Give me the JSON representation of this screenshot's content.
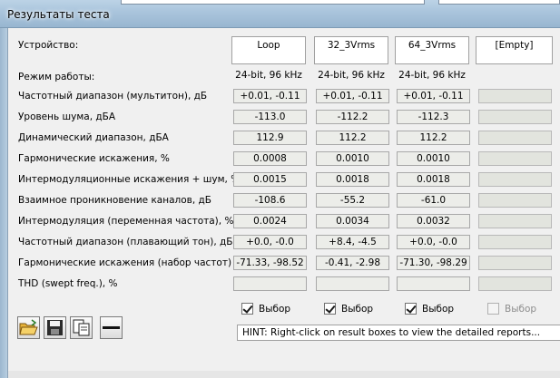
{
  "window": {
    "title": "Результаты теста"
  },
  "device_label": "Устройство:",
  "columns": [
    {
      "header": "Loop",
      "mode": "24-bit, 96 kHz"
    },
    {
      "header": "32_3Vrms",
      "mode": "24-bit, 96 kHz"
    },
    {
      "header": "64_3Vrms",
      "mode": "24-bit, 96 kHz"
    },
    {
      "header": "[Empty]",
      "mode": ""
    }
  ],
  "mode_label": "Режим работы:",
  "rows": [
    {
      "label": "Частотный диапазон (мультитон), дБ",
      "values": [
        "+0.01, -0.11",
        "+0.01, -0.11",
        "+0.01, -0.11",
        ""
      ]
    },
    {
      "label": "Уровень шума, дБА",
      "values": [
        "-113.0",
        "-112.2",
        "-112.3",
        ""
      ]
    },
    {
      "label": "Динамический диапазон, дБА",
      "values": [
        "112.9",
        "112.2",
        "112.2",
        ""
      ]
    },
    {
      "label": "Гармонические искажения, %",
      "values": [
        "0.0008",
        "0.0010",
        "0.0010",
        ""
      ]
    },
    {
      "label": "Интермодуляционные искажения + шум, %",
      "values": [
        "0.0015",
        "0.0018",
        "0.0018",
        ""
      ]
    },
    {
      "label": "Взаимное проникновение каналов, дБ",
      "values": [
        "-108.6",
        "-55.2",
        "-61.0",
        ""
      ]
    },
    {
      "label": "Интермодуляция (переменная частота), %",
      "values": [
        "0.0024",
        "0.0034",
        "0.0032",
        ""
      ]
    },
    {
      "label": "Частотный диапазон (плавающий тон), дБ",
      "values": [
        "+0.0, -0.0",
        "+8.4, -4.5",
        "+0.0, -0.0",
        ""
      ]
    },
    {
      "label": "Гармонические искажения (набор частот)",
      "values": [
        "-71.33, -98.52",
        "-0.41, -2.98",
        "-71.30, -98.29",
        ""
      ]
    },
    {
      "label": "THD (swept freq.), %",
      "values": [
        "",
        "",
        "",
        ""
      ]
    }
  ],
  "checkboxes": [
    {
      "label": "Выбор",
      "checked": true,
      "enabled": true
    },
    {
      "label": "Выбор",
      "checked": true,
      "enabled": true
    },
    {
      "label": "Выбор",
      "checked": true,
      "enabled": true
    },
    {
      "label": "Выбор",
      "checked": false,
      "enabled": false
    }
  ],
  "hint": "HINT: Right-click on result boxes to view the detailed reports...",
  "toolbar": [
    {
      "icon": "open-folder-icon"
    },
    {
      "icon": "save-disk-icon"
    },
    {
      "icon": "copy-pages-icon"
    },
    {
      "icon": "minus-icon"
    }
  ],
  "colors": {
    "cell_bg": "#ecede9",
    "title_bar": "#a9c4dc",
    "client_bg": "#f0f0f0"
  }
}
